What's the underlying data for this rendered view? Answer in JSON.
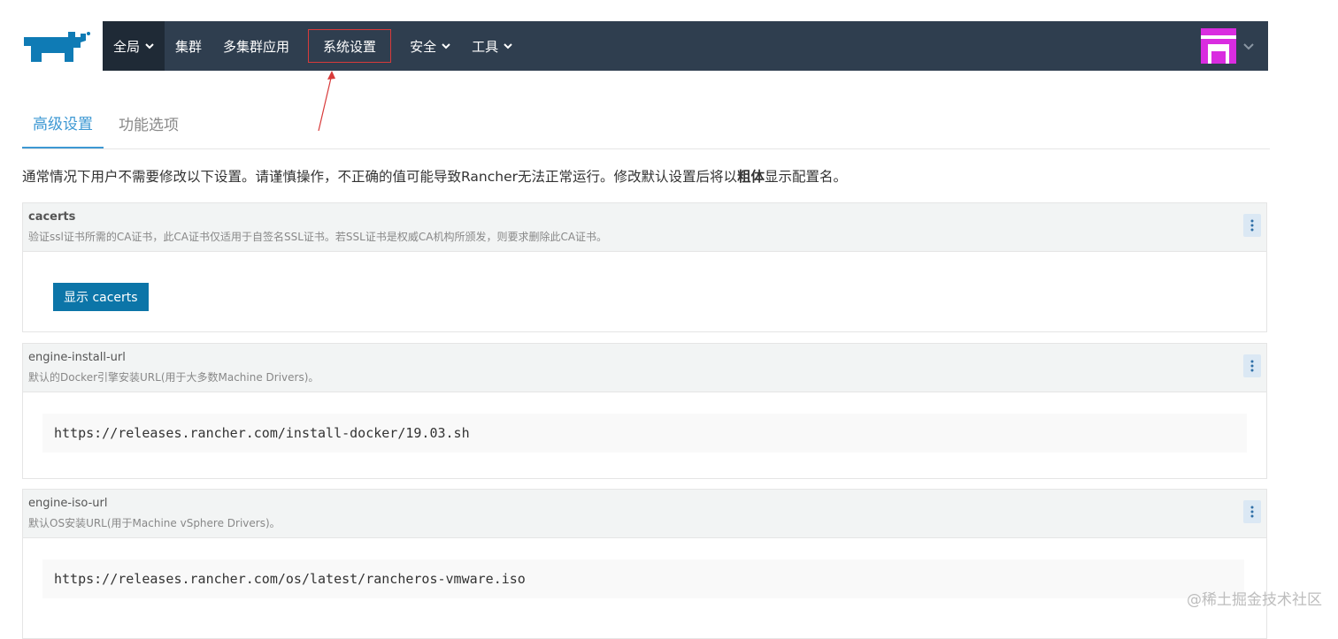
{
  "nav": {
    "items": [
      {
        "label": "全局",
        "has_dropdown": true,
        "active": true
      },
      {
        "label": "集群",
        "has_dropdown": false
      },
      {
        "label": "多集群应用",
        "has_dropdown": false
      },
      {
        "label": "系统设置",
        "has_dropdown": false,
        "highlighted": true
      },
      {
        "label": "安全",
        "has_dropdown": true
      },
      {
        "label": "工具",
        "has_dropdown": true
      }
    ]
  },
  "tabs": [
    {
      "label": "高级设置",
      "active": true
    },
    {
      "label": "功能选项",
      "active": false
    }
  ],
  "description": {
    "before": "通常情况下用户不需要修改以下设置。请谨慎操作，不正确的值可能导致Rancher无法正常运行。修改默认设置后将以",
    "bold": "粗体",
    "after": "显示配置名。"
  },
  "settings": [
    {
      "name": "cacerts",
      "description": "验证ssl证书所需的CA证书，此CA证书仅适用于自签名SSL证书。若SSL证书是权威CA机构所颁发，则要求删除此CA证书。",
      "button_label": "显示 cacerts"
    },
    {
      "name": "engine-install-url",
      "description": "默认的Docker引擎安装URL(用于大多数Machine Drivers)。",
      "value": "https://releases.rancher.com/install-docker/19.03.sh"
    },
    {
      "name": "engine-iso-url",
      "description": "默认OS安装URL(用于Machine vSphere Drivers)。",
      "value": "https://releases.rancher.com/os/latest/rancheros-vmware.iso"
    }
  ],
  "watermark": "@稀土掘金技术社区",
  "colors": {
    "nav_bg": "#2f3e4f",
    "accent": "#3d98d3",
    "button": "#0c75a8",
    "highlight_box": "#d83a3a",
    "avatar": "#d92ce0"
  }
}
